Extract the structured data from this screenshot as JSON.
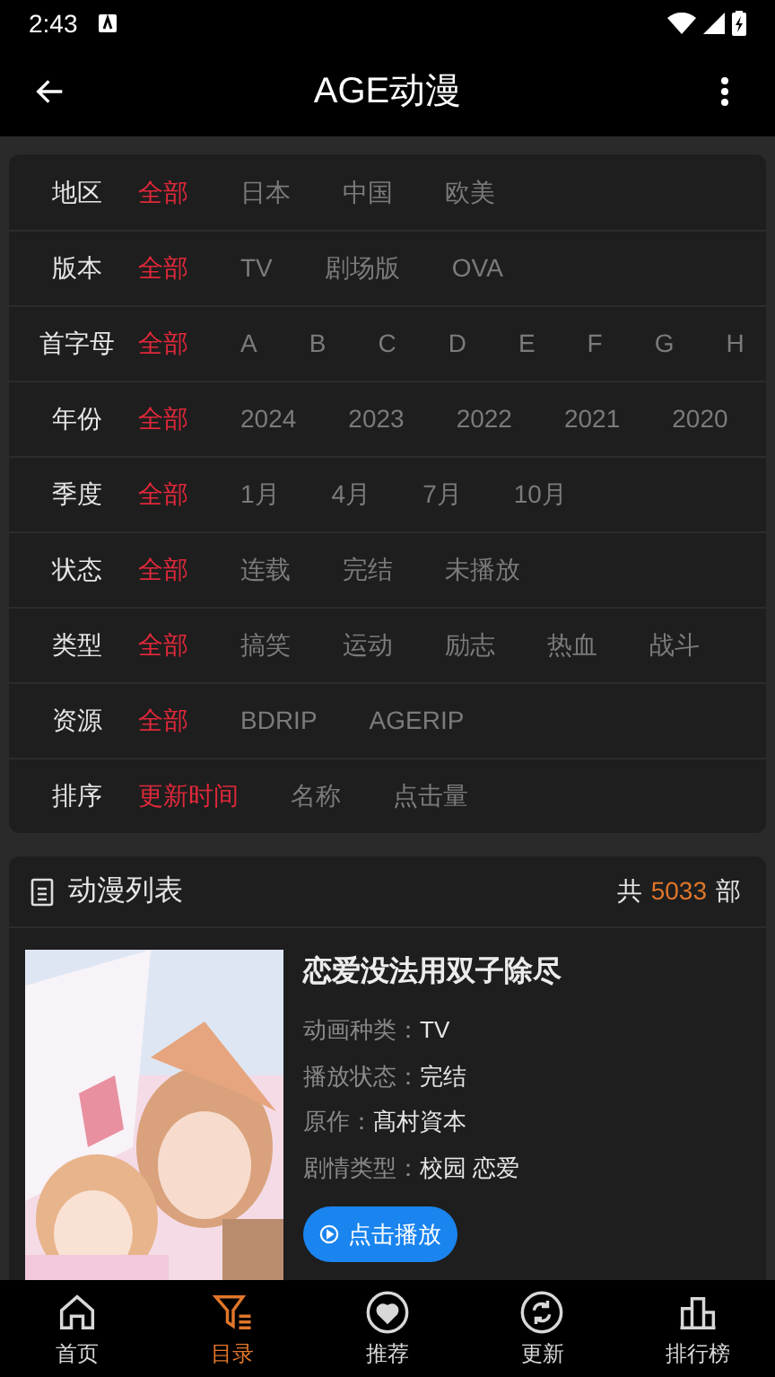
{
  "status_bar": {
    "time": "2:43"
  },
  "app_bar": {
    "title": "AGE动漫"
  },
  "filters": [
    {
      "label": "地区",
      "options": [
        {
          "text": "全部",
          "selected": true
        },
        {
          "text": "日本",
          "selected": false
        },
        {
          "text": "中国",
          "selected": false
        },
        {
          "text": "欧美",
          "selected": false
        }
      ]
    },
    {
      "label": "版本",
      "options": [
        {
          "text": "全部",
          "selected": true
        },
        {
          "text": "TV",
          "selected": false
        },
        {
          "text": "剧场版",
          "selected": false
        },
        {
          "text": "OVA",
          "selected": false
        }
      ]
    },
    {
      "label": "首字母",
      "options": [
        {
          "text": "全部",
          "selected": true
        },
        {
          "text": "A",
          "selected": false
        },
        {
          "text": "B",
          "selected": false
        },
        {
          "text": "C",
          "selected": false
        },
        {
          "text": "D",
          "selected": false
        },
        {
          "text": "E",
          "selected": false
        },
        {
          "text": "F",
          "selected": false
        },
        {
          "text": "G",
          "selected": false
        },
        {
          "text": "H",
          "selected": false
        }
      ]
    },
    {
      "label": "年份",
      "options": [
        {
          "text": "全部",
          "selected": true
        },
        {
          "text": "2024",
          "selected": false
        },
        {
          "text": "2023",
          "selected": false
        },
        {
          "text": "2022",
          "selected": false
        },
        {
          "text": "2021",
          "selected": false
        },
        {
          "text": "2020",
          "selected": false
        }
      ]
    },
    {
      "label": "季度",
      "options": [
        {
          "text": "全部",
          "selected": true
        },
        {
          "text": "1月",
          "selected": false
        },
        {
          "text": "4月",
          "selected": false
        },
        {
          "text": "7月",
          "selected": false
        },
        {
          "text": "10月",
          "selected": false
        }
      ]
    },
    {
      "label": "状态",
      "options": [
        {
          "text": "全部",
          "selected": true
        },
        {
          "text": "连载",
          "selected": false
        },
        {
          "text": "完结",
          "selected": false
        },
        {
          "text": "未播放",
          "selected": false
        }
      ]
    },
    {
      "label": "类型",
      "options": [
        {
          "text": "全部",
          "selected": true
        },
        {
          "text": "搞笑",
          "selected": false
        },
        {
          "text": "运动",
          "selected": false
        },
        {
          "text": "励志",
          "selected": false
        },
        {
          "text": "热血",
          "selected": false
        },
        {
          "text": "战斗",
          "selected": false
        }
      ]
    },
    {
      "label": "资源",
      "options": [
        {
          "text": "全部",
          "selected": true
        },
        {
          "text": "BDRIP",
          "selected": false
        },
        {
          "text": "AGERIP",
          "selected": false
        }
      ]
    },
    {
      "label": "排序",
      "options": [
        {
          "text": "更新时间",
          "selected": true
        },
        {
          "text": "名称",
          "selected": false
        },
        {
          "text": "点击量",
          "selected": false
        }
      ]
    }
  ],
  "list": {
    "title": "动漫列表",
    "count_prefix": "共",
    "count": "5033",
    "count_suffix": "部",
    "items": [
      {
        "picture": {
          "kind": "picture"
        },
        "title": "恋爱没法用双子除尽",
        "fields": [
          {
            "label": "动画种类：",
            "value": "TV"
          },
          {
            "label": "播放状态：",
            "value": "完结"
          },
          {
            "label": "原作：",
            "value": "髙村資本"
          },
          {
            "label": "剧情类型：",
            "value": "校园 恋爱"
          }
        ],
        "play_button": "点击播放"
      }
    ]
  },
  "bottom_nav": [
    {
      "label": "首页",
      "selected": false
    },
    {
      "label": "目录",
      "selected": true
    },
    {
      "label": "推荐",
      "selected": false
    },
    {
      "label": "更新",
      "selected": false
    },
    {
      "label": "排行榜",
      "selected": false
    }
  ]
}
